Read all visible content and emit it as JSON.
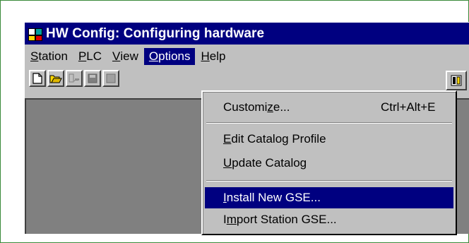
{
  "window": {
    "title": "HW Config: Configuring hardware"
  },
  "menubar": {
    "station": {
      "key": "S",
      "rest": "tation"
    },
    "plc": {
      "key": "P",
      "rest": "LC"
    },
    "view": {
      "key": "V",
      "rest": "iew"
    },
    "options": {
      "key": "O",
      "rest": "ptions"
    },
    "help": {
      "key": "H",
      "rest": "elp"
    }
  },
  "options_menu": {
    "customize": {
      "pre": "Customi",
      "key": "z",
      "post": "e...",
      "shortcut": "Ctrl+Alt+E"
    },
    "edit_catalog_profile": {
      "key": "E",
      "rest": "dit Catalog Profile"
    },
    "update_catalog": {
      "key": "U",
      "rest": "pdate Catalog"
    },
    "install_new_gse": {
      "key": "I",
      "rest": "nstall New GSE..."
    },
    "import_station_gse": {
      "pre": "I",
      "key": "m",
      "rest": "port Station GSE..."
    }
  },
  "toolbar": {
    "icons": [
      "new-icon",
      "open-icon",
      "accessible-nodes-icon",
      "save-icon",
      "save-compile-icon",
      "catalog-icon"
    ]
  },
  "colors": {
    "title_bar": "#000080",
    "face": "#c0c0c0",
    "workspace": "#808080",
    "highlight": "#000080",
    "frame_border": "#3a8a3a"
  }
}
